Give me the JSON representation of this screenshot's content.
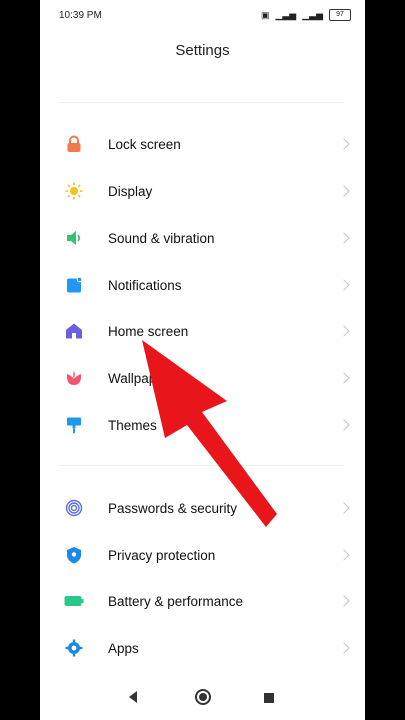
{
  "status": {
    "time": "10:39 PM",
    "battery": "97"
  },
  "title": "Settings",
  "groups": [
    [
      {
        "label": "Lock screen",
        "icon": "lock-icon"
      },
      {
        "label": "Display",
        "icon": "sun-icon"
      },
      {
        "label": "Sound & vibration",
        "icon": "speaker-icon"
      },
      {
        "label": "Notifications",
        "icon": "notification-icon"
      },
      {
        "label": "Home screen",
        "icon": "home-icon"
      },
      {
        "label": "Wallpaper",
        "icon": "flower-icon"
      },
      {
        "label": "Themes",
        "icon": "brush-icon"
      }
    ],
    [
      {
        "label": "Passwords & security",
        "icon": "fingerprint-icon"
      },
      {
        "label": "Privacy protection",
        "icon": "shield-icon"
      },
      {
        "label": "Battery & performance",
        "icon": "battery-icon"
      },
      {
        "label": "Apps",
        "icon": "gear-icon"
      }
    ]
  ],
  "colors": {
    "arrow": "#e8161b",
    "lock": "#f07a4d",
    "sun": "#f6c021",
    "sound": "#33c273",
    "notif": "#2196f3",
    "home": "#6b5fe0",
    "flower": "#f0566a"
  }
}
